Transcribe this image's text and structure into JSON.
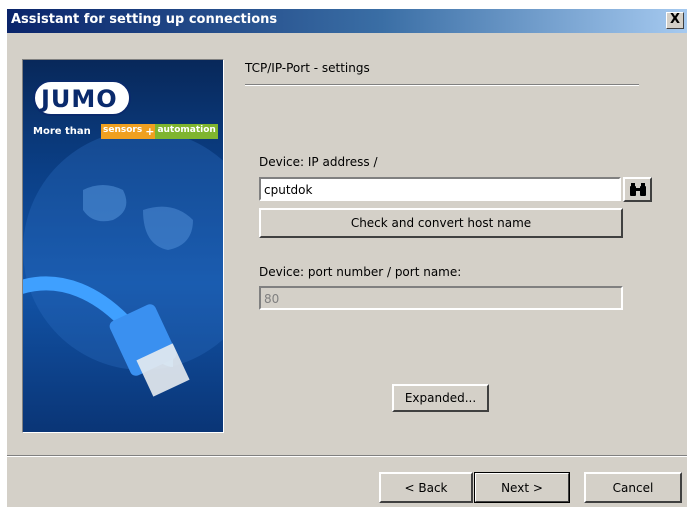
{
  "window": {
    "title": "Assistant for setting up connections",
    "close_label": "X"
  },
  "banner": {
    "logo_text": "JUMO",
    "tagline_prefix": "More than",
    "tagline_sensors": "sensors",
    "tagline_plus": "+",
    "tagline_automation": "automation"
  },
  "page": {
    "heading": "TCP/IP-Port - settings"
  },
  "ip": {
    "label": "Device: IP address /",
    "value": "cputdok",
    "browse_icon": "binoculars-icon"
  },
  "check_button": "Check and convert host name",
  "port": {
    "label": "Device:  port number / port name:",
    "value": "80"
  },
  "expanded_button": "Expanded...",
  "footer": {
    "back": "< Back",
    "next": "Next >",
    "cancel": "Cancel"
  }
}
